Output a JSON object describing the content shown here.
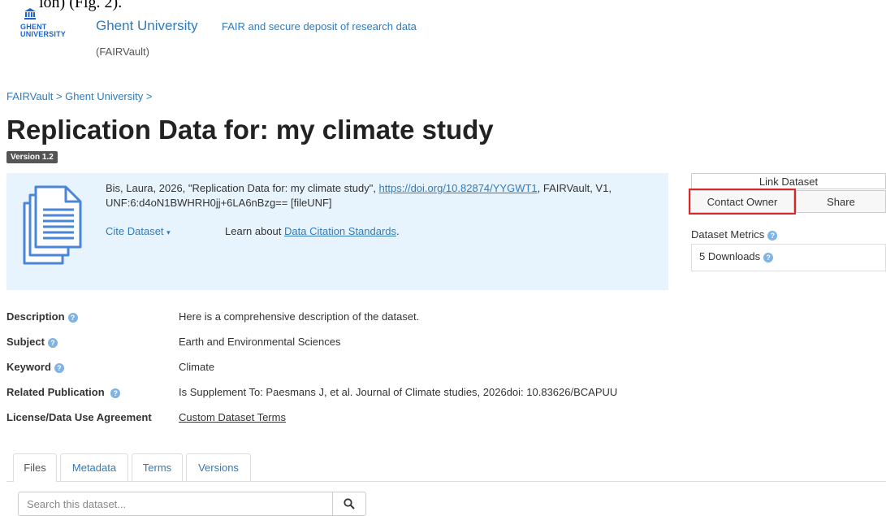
{
  "top_cut_text": "ion) (Fig. 2).",
  "header": {
    "logo_line1": "GHENT",
    "logo_line2": "UNIVERSITY",
    "brand": "Ghent University",
    "brand_sub": "(FAIRVault)",
    "tagline": "FAIR and secure deposit of research data"
  },
  "breadcrumb": [
    "FAIRVault",
    "Ghent University"
  ],
  "title": "Replication Data for: my climate study",
  "version": "Version 1.2",
  "citation": {
    "text_before": "Bis, Laura, 2026, \"Replication Data for: my climate study\", ",
    "doi_link": "https://doi.org/10.82874/YYGWT1",
    "text_after": ", FAIRVault, V1, UNF:6:d4oN1BWHRH0jj+6LA6nBzg== [fileUNF]",
    "cite_dataset": "Cite Dataset",
    "learn_prefix": "Learn about ",
    "learn_link": "Data Citation Standards",
    "learn_suffix": "."
  },
  "panel": {
    "link_dataset": "Link Dataset",
    "contact_owner": "Contact Owner",
    "share": "Share",
    "metrics_title": "Dataset Metrics",
    "downloads": "5 Downloads"
  },
  "metadata": [
    {
      "label": "Description",
      "value": "Here is a comprehensive description of the dataset.",
      "help": true
    },
    {
      "label": "Subject",
      "value": "Earth and Environmental Sciences",
      "help": true
    },
    {
      "label": "Keyword",
      "value": "Climate",
      "help": true
    },
    {
      "label": "Related Publication",
      "value": "Is Supplement To: Paesmans J, et al. Journal of Climate studies, 2026doi: 10.83626/BCAPUU",
      "help": true
    },
    {
      "label": "License/Data Use Agreement",
      "value": "Custom Dataset Terms",
      "help": false
    }
  ],
  "tabs": [
    "Files",
    "Metadata",
    "Terms",
    "Versions"
  ],
  "search": {
    "placeholder": "Search this dataset..."
  },
  "colors": {
    "link": "#337ab7",
    "highlight": "#d9262b",
    "citation_bg": "#e8f4fd",
    "icon": "#4a86d8"
  }
}
